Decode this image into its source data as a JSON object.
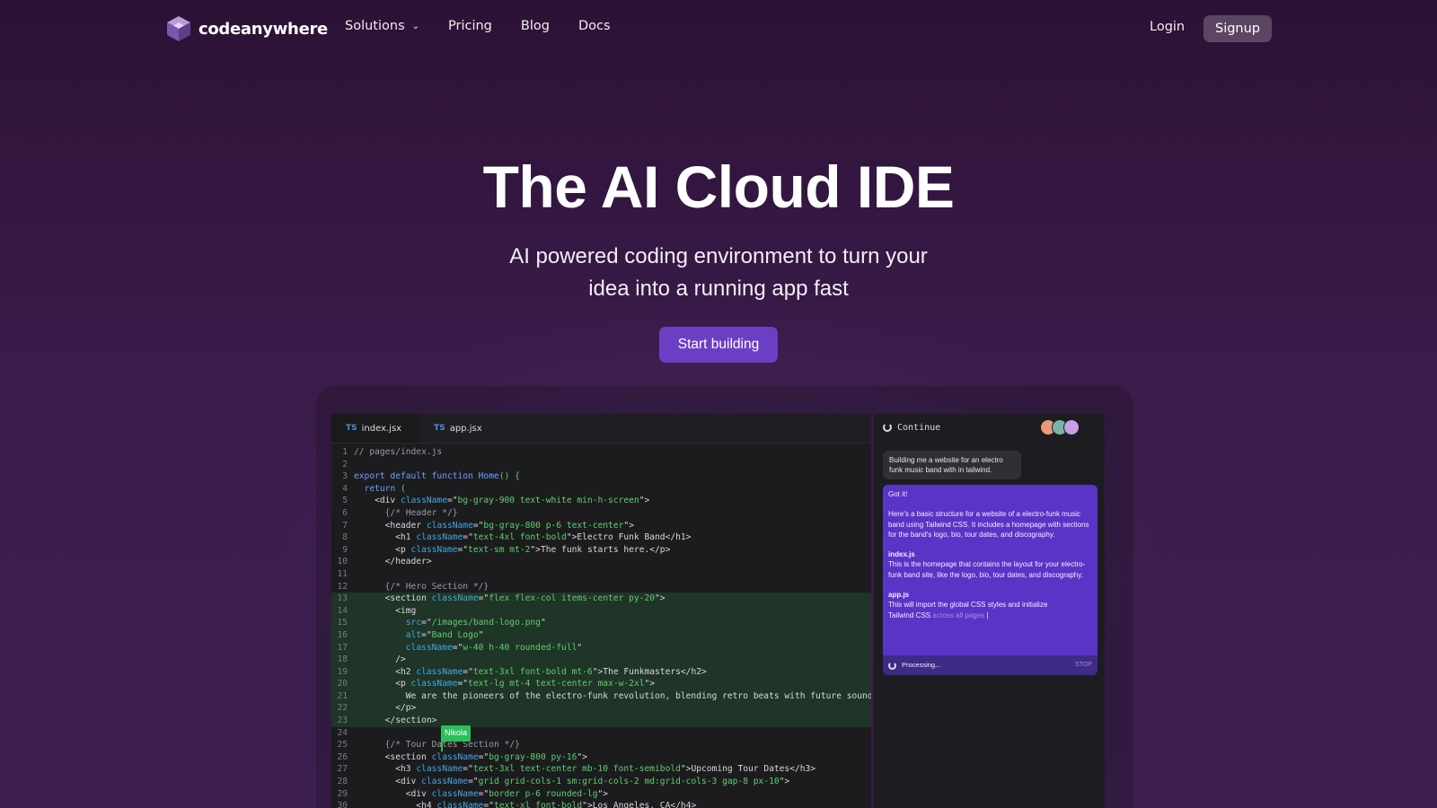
{
  "nav": {
    "brand": "codeanywhere",
    "links": [
      "Solutions",
      "Pricing",
      "Blog",
      "Docs"
    ],
    "login": "Login",
    "signup": "Signup"
  },
  "hero": {
    "title": "The AI Cloud IDE",
    "subtitle_line1": "AI powered coding environment to turn your",
    "subtitle_line2": "idea into a running app fast",
    "cta": "Start building"
  },
  "editor": {
    "tabs": [
      {
        "lang": "TS",
        "name": "index.jsx"
      },
      {
        "lang": "TS",
        "name": "app.jsx"
      }
    ],
    "highlight_lines": [
      13,
      23
    ],
    "collaborator": "Nikola",
    "lines": [
      "// pages/index.js",
      "",
      "export default function Home() {",
      "  return (",
      "    <div className=\"bg-gray-900 text-white min-h-screen\">",
      "      {/* Header */}",
      "      <header className=\"bg-gray-800 p-6 text-center\">",
      "        <h1 className=\"text-4xl font-bold\">Electro Funk Band</h1>",
      "        <p className=\"text-sm mt-2\">The funk starts here.</p>",
      "      </header>",
      "",
      "      {/* Hero Section */}",
      "      <section className=\"flex flex-col items-center py-20\">",
      "        <img",
      "          src=\"/images/band-logo.png\"",
      "          alt=\"Band Logo\"",
      "          className=\"w-40 h-40 rounded-full\"",
      "        />",
      "        <h2 className=\"text-3xl font-bold mt-6\">The Funkmasters</h2>",
      "        <p className=\"text-lg mt-4 text-center max-w-2xl\">",
      "          We are the pioneers of the electro-funk revolution, blending retro beats with future sounds.",
      "        </p>",
      "      </section>",
      "",
      "      {/* Tour Dates Section */}",
      "      <section className=\"bg-gray-800 py-16\">",
      "        <h3 className=\"text-3xl text-center mb-10 font-semibold\">Upcoming Tour Dates</h3>",
      "        <div className=\"grid grid-cols-1 sm:grid-cols-2 md:grid-cols-3 gap-8 px-10\">",
      "          <div className=\"border p-6 rounded-lg\">",
      "            <h4 className=\"text-xl font-bold\">Los Angeles, CA</h4>"
    ]
  },
  "chat": {
    "header": "Continue",
    "avatar_colors": [
      "#e89a7a",
      "#7ab6a8",
      "#c9a0e6"
    ],
    "user_message": "Building me a website for an electro funk music band with in tailwind.",
    "ai_reply": {
      "intro": "Got it!",
      "summary": "Here's a basic structure for a website of a electro-funk music band using Tailwind CSS. It includes a homepage with sections for the band's logo, bio, tour dates, and discography.",
      "file1_title": "index.js",
      "file1_text": "This is the homepage that contains the layout for your electro-funk band site, like the logo, bio, tour dates, and discography.",
      "file2_title": "app.js",
      "file2_text": "This will import the global CSS styles and initialize",
      "file2_text2": "Tailwind CSS",
      "file2_fade": " across all pages"
    },
    "status": "Processing...",
    "stop": "STOP"
  },
  "colors": {
    "accent": "#6b3fc4",
    "ai_bubble": "#5a34c6",
    "collab": "#29c05a"
  }
}
